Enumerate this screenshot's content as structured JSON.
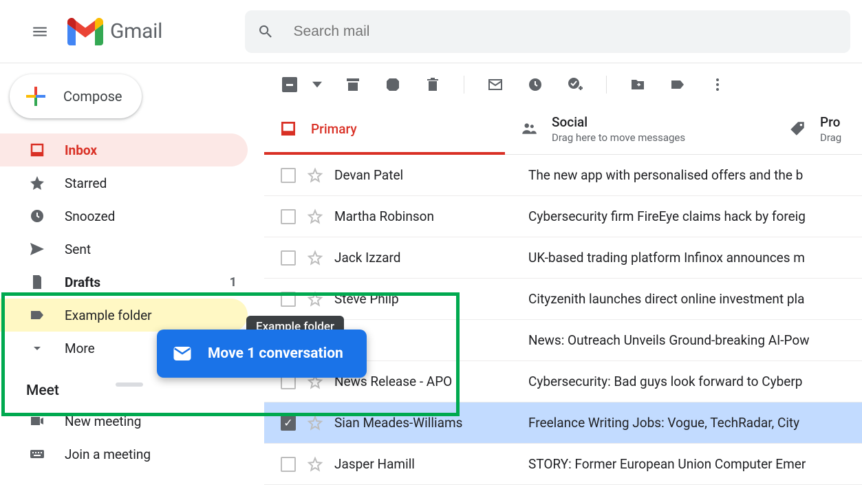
{
  "header": {
    "app_name": "Gmail",
    "search_placeholder": "Search mail"
  },
  "compose_label": "Compose",
  "sidebar": {
    "items": [
      {
        "label": "Inbox"
      },
      {
        "label": "Starred"
      },
      {
        "label": "Snoozed"
      },
      {
        "label": "Sent"
      },
      {
        "label": "Drafts",
        "count": "1"
      },
      {
        "label": "Example folder"
      },
      {
        "label": "More"
      }
    ],
    "meet_header": "Meet",
    "meet_items": [
      {
        "label": "New meeting"
      },
      {
        "label": "Join a meeting"
      }
    ]
  },
  "tabs": [
    {
      "title": "Primary"
    },
    {
      "title": "Social",
      "sub": "Drag here to move messages"
    },
    {
      "title": "Pro",
      "sub": "Drag"
    }
  ],
  "emails": [
    {
      "sender": "Devan Patel",
      "subject": "The new app with personalised offers and the b"
    },
    {
      "sender": "Martha Robinson",
      "subject": "Cybersecurity firm FireEye claims hack by foreig"
    },
    {
      "sender": "Jack Izzard",
      "subject": "UK-based trading platform Infinox announces m"
    },
    {
      "sender": "Steve Philp",
      "subject": "Cityzenith launches direct online investment pla"
    },
    {
      "sender": "",
      "subject": "News: Outreach Unveils Ground-breaking AI-Pow"
    },
    {
      "sender": "News Release - APO .",
      "subject": "Cybersecurity: Bad guys look forward to Cyberp"
    },
    {
      "sender": "Sian Meades-Williams",
      "subject": "Freelance Writing Jobs: Vogue, TechRadar, City",
      "selected": true
    },
    {
      "sender": "Jasper Hamill",
      "subject": "STORY: Former European Union Computer Emer"
    }
  ],
  "drag": {
    "tooltip": "Example folder",
    "toast": "Move 1 conversation"
  }
}
